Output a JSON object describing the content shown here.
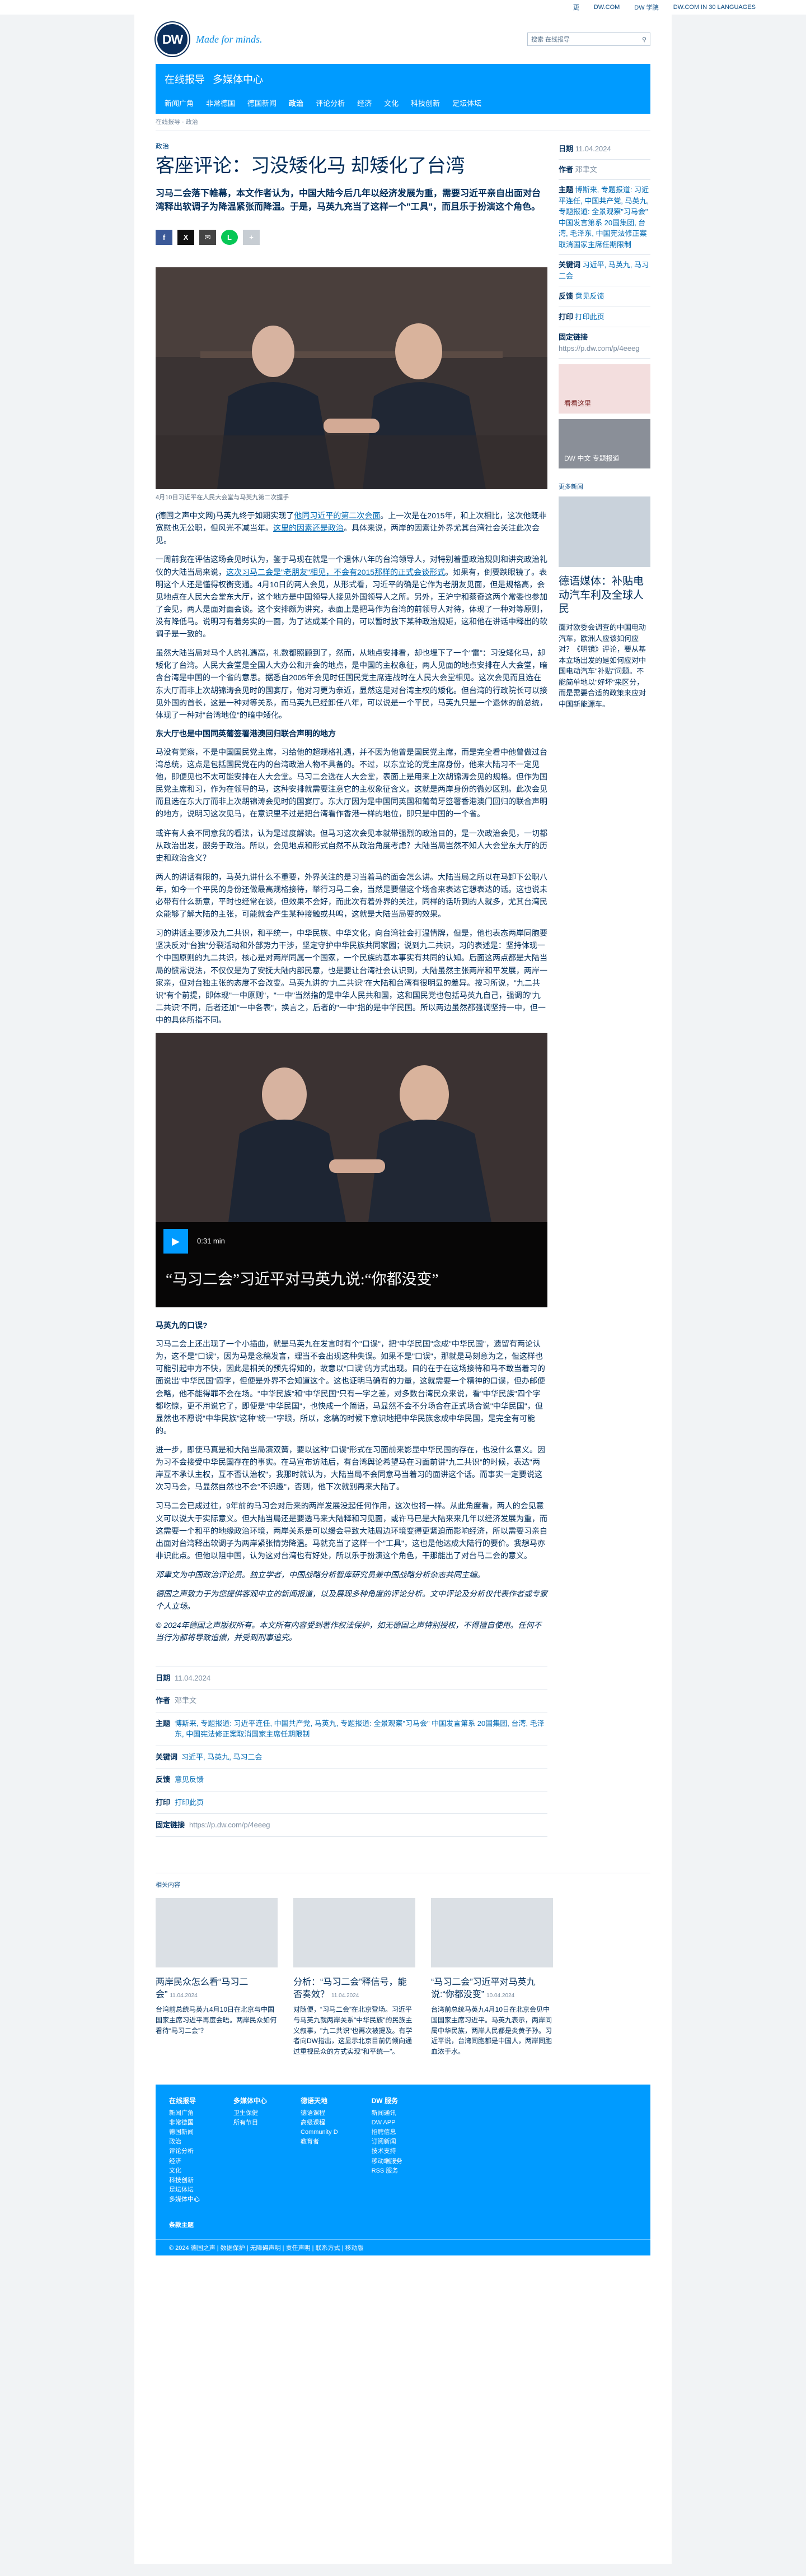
{
  "topbar": {
    "l1": "更",
    "l2": "DW.COM",
    "l3": "DW 学院",
    "l4": "DW.COM IN 30 LANGUAGES"
  },
  "brand": {
    "logo": "DW",
    "slogan": "Made for minds.",
    "search_placeholder": "搜索 在线报导"
  },
  "header": {
    "section": "在线报导",
    "subsection": "多媒体中心",
    "nav": [
      "新闻广角",
      "非常德国",
      "德国新闻",
      "政治",
      "评论分析",
      "经济",
      "文化",
      "科技创新",
      "足坛体坛"
    ]
  },
  "breadcrumb": "在线报导 · 政治",
  "article": {
    "kicker": "政治",
    "title": "客座评论：习没矮化马 却矮化了台湾",
    "lede": "习马二会落下帷幕，本文作者认为，中国大陆今后几年以经济发展为重，需要习近平亲自出面对台湾释出软调子为降温紧张而降温。于是，马英九充当了这样一个\"工具\"，而且乐于扮演这个角色。",
    "caption": "4月10日习近平在人民大会堂与马英九第二次握手",
    "p1a": "(德国之声中文网)马英九终于如期实现了",
    "p1link": "他同习近平的第二次会面",
    "p1b": "。上一次是在2015年，和上次相比，这次他既非宽慰也无公职，但风光不减当年。",
    "p1link2": "这里的因素还是政治",
    "p1c": "。具体来说，两岸的因素让外界尤其台湾社会关注此次会见。",
    "p2a": "一周前我在评估这场会见时认为，鉴于马现在就是一个退休八年的台湾领导人，对特别着重政治规则和讲究政治礼仪的大陆当局来说，",
    "p2link": "这次习马二会是\"老朋友\"相见，不会有2015那样的正式会谈形式",
    "p2b": "。如果有，倒要跌眼镜了。表明这个人还是懂得权衡变通。4月10日的两人会见，从形式看，习近平的确是它作为老朋友见面，但是规格高，会见地点在人民大会堂东大厅，这个地方是中国领导人接见外国领导人之所。另外，王沪宁和蔡奇这两个常委也参加了会见，两人是面对面会谈。这个安排颇为讲究，表面上是把马作为台湾的前领导人对待，体现了一种对等原则，没有降低马。说明习有着务实的一面，为了达成某个目的，可以暂时放下某种政治规矩，这和他在讲话中释出的软调子是一致的。",
    "p3": "虽然大陆当局对马个人的礼遇高，礼数都照顾到了，然而，从地点安排看，却也埋下了一个\"雷\"：习没矮化马，却矮化了台湾。人民大会堂是全国人大办公和开会的地点，是中国的主权象征，两人见面的地点安排在人大会堂，暗含台湾是中国的一个省的意思。据悉自2005年会见时任国民党主席连战时在人民大会堂相见。这次会见而且选在东大厅而非上次胡锦涛会见时的国宴厅，他对习更为亲近，显然这是对台湾主权的矮化。但台湾的行政院长可以接见外国的首长，这是一种对等关系，而马英九已经卸任八年，可以说是一个平民，马英九只是一个退休的前总统，体现了一种对\"台湾地位\"的暗中矮化。",
    "h1": "东大厅也是中国同英葡签署港澳回归联合声明的地方",
    "p4": "马没有觉察，不是中国国民党主席，习给他的超规格礼遇，并不因为他曾是国民党主席，而是完全看中他曾做过台湾总统，这点是包括国民党在内的台湾政治人物不具备的。不过，以东立论的党主席身份，他来大陆习不一定见他，即便见也不太可能安排在人大会堂。马习二会选在人大会堂，表面上是用来上次胡锦涛会见的规格。但作为国民党主席和习，作为在领导的马，这种安排就需要注意它的主权象征含义。这就是两岸身份的微妙区别。此次会见而且选在东大厅而非上次胡锦涛会见时的国宴厅。东大厅因为是中国同英国和葡萄牙签署香港澳门回归的联合声明的地方，说明习这次见马，在意识里不过是把台湾看作香港一样的地位，即只是中国的一个省。",
    "p5": "或许有人会不同意我的看法，认为是过度解读。但马习这次会见本就带强烈的政治目的，是一次政治会见，一切都从政治出发，服务于政治。所以，会见地点和形式自然不从政治角度考虑？大陆当局岂然不知人大会堂东大厅的历史和政治含义？",
    "p6": "两人的讲话有限的，马英九讲什么不重要，外界关注的是习当着马的面会怎么讲。大陆当局之所以在马卸下公职八年，如今一个平民的身份还做最高规格接待，举行习马二会，当然是要借这个场合来表达它想表达的话。这也说未必带有什么新意，平时也经常在谈，但效果不会好，而此次有着外界的关注，同样的话听到的人就多，尤其台湾民众能够了解大陆的主张，可能就会产生某种接触或共鸣，这就是大陆当局要的效果。",
    "p7": "习的讲话主要涉及九二共识，和平统一，中华民族、中华文化，向台湾社会打温情牌，但是，他也表态两岸同胞要坚决反对\"台独\"分裂活动和外部势力干涉，坚定守护中华民族共同家园；说到九二共识，习的表述是：坚持体现一个中国原则的九二共识，核心是对两岸同属一个国家，一个民族的基本事实有共同的认知。后面这两点都是大陆当局的惯常说法，不仅仅是为了安抚大陆内部民意，也是要让台湾社会认识到，大陆虽然主张两岸和平发展，两岸一家亲，但对台独主张的态度不会改变。马英九讲的\"九二共识\"在大陆和台湾有很明显的差异。按习所说，\"九二共识\"有个前提，即体现\"一中原则\"，\"一中\"当然指的是中华人民共和国，这和国民党也包括马英九自己，强调的\"九二共识\"不同，后者还加\"一中各表\"，换言之，后者的\"一中\"指的是中华民国。所以两边虽然都强调坚持一中，但一中的具体所指不同。",
    "h2": "马英九的口误?",
    "p8": "习马二会上还出现了一个小插曲，就是马英九在发言时有个\"口误\"，把\"中华民国\"念成\"中华民国\"，遗留有两论认为，这不是\"口误\"，因为马是念稿发言，理当不会出现这种失误。如果不是\"口误\"，那就是马刻意为之，但这样也可能引起中方不快，因此是相关的预先得知的，故意以\"口误\"的方式出现。目的在于在这场接待和马不敢当着习的面说出\"中华民国\"四字，但便是外界不会知道这个。这也证明马确有的力量，这就需要一个精神的口误，但办邮便会略，他不能得罪不会在场。\"中华民族\"和\"中华民国\"只有一字之差，对多数台湾民众来说，看\"中华民族\"四个字都吃惊，更不用说它了，即便是\"中华民国\"，也快成一个简语，马显然不会不分场合在正式场合说\"中华民国\"，但显然也不愿说\"中华民族\"这种\"统一\"字眼，所以，念稿的时候下意识地把中华民族念成中华民国，是完全有可能的。",
    "p9": "进一步，即使马真是和大陆当局演双簧，要以这种\"口误\"形式在习面前来影显中华民国的存在，也没什么意义。因为习不会接受中华民国存在的事实。在马宣布访陆后，有台湾舆论希望马在习面前讲\"九二共识\"的时候，表达\"两岸互不承认主权，互不否认治权\"，我那时就认为，大陆当局不会同意马当着习的面讲这个话。而事实一定要说这次习马会，马显然自然也不会\"不识趣\"，否则，他下次就别再来大陆了。",
    "p10": "习马二会已成过往，9年前的马习会对后来的两岸发展没起任何作用，这次也将一样。从此角度看，两人的会见意义可以说大于实际意义。但大陆当局还是要透马来大陆释和习见面，或许马已是大陆来来几年以经济发展为重，而这需要一个和平的地缘政治环境，两岸关系是可以缓会导致大陆周边环境变得更紧迫而影响经济，所以需要习亲自出面对台湾释出软调子为两岸紧张情势降温。马就充当了这样一个\"工具\"，这也是他达成大陆行的要价。我想马亦非识此点。但他以阻中国，认为这对台湾也有好处，所以乐于扮演这个角色，干那能出了对台马二会的意义。",
    "author_note": "邓聿文为中国政治评论员。独立学者，中国战略分析智库研究员兼中国战略分析杂志共同主编。",
    "disclaimer": "德国之声致力于为您提供客观中立的新闻报道，以及展现多种角度的评论分析。文中评论及分析仅代表作者或专家个人立场。",
    "copyright": "© 2024年德国之声版权所有。本文所有内容受到著作权法保护，如无德国之声特别授权，不得擅自使用。任何不当行为都将导致追偿，并受到刑事追究。"
  },
  "video": {
    "duration": "0:31 min",
    "title": "“马习二会”习近平对马英九说:“你都没变”"
  },
  "meta": {
    "date_k": "日期",
    "date_v": "11.04.2024",
    "author_k": "作者",
    "author_v": "邓聿文",
    "topic_k": "主题",
    "topic_v": "博斯来, 专题报道: 习近平连任, 中国共产党, 马英九, 专题报道: 全景观察\"习马会\" 中国发言第系 20国集团, 台湾, 毛泽东, 中国宪法修正案取消国家主席任期限制",
    "kw_k": "关键词",
    "kw_v": "习近平, 马英九, 马习二会",
    "fb_k": "反馈",
    "fb_v": "意见反馈",
    "print_k": "打印",
    "print_v": "打印此页",
    "link_k": "固定链接",
    "link_v": "https://p.dw.com/p/4eeeg"
  },
  "sidebar": {
    "date_k": "日期",
    "date_v": "11.04.2024",
    "author_k": "作者",
    "author_v": "邓聿文",
    "topic_k": "主题",
    "topic_v": "博斯来, 专题报道: 习近平连任, 中国共产党, 马英九, 专题报道: 全景观察\"习马会\" 中国发言第系 20国集团, 台湾, 毛泽东, 中国宪法修正案取消国家主席任期限制",
    "kw_k": "关键词",
    "kw_v": "习近平, 马英九, 马习二会",
    "fb_k": "反馈",
    "fb_v": "意见反馈",
    "print_k": "打印",
    "print_v": "打印此页",
    "link_k": "固定链接",
    "link_v": "https://p.dw.com/p/4eeeg",
    "promo1": "看看这里",
    "promo2": "DW 中文 专题报道",
    "more_h": "更多新闻",
    "story_title": "德语媒体：补贴电动汽车利及全球人民",
    "story_text": "面对欧委会调查的中国电动汽车，欧洲人应该如何应对？《明镜》评论，要从基本立场出发的是如何应对中国电动汽车\"补贴\"问题。不能简单地以\"好坏\"来区分，而是需要合适的政策来应对中国新能源车。"
  },
  "related": {
    "heading": "相关内容",
    "cards": [
      {
        "title": "两岸民众怎么看“马习二会”",
        "date": "11.04.2024",
        "desc": "台湾前总统马英九4月10日在北京与中国国家主席习近平再度会晤。两岸民众如何看待“马习二会”？"
      },
      {
        "title": "分析：“马习二会”释信号，能否奏效？",
        "date": "11.04.2024",
        "desc": "对随便，“习马二会”在北京登场。习近平与马英九就两岸关系\"中华民族\"的民族主义叙事，\"九二共识\"也再次被提及。有学者向DW指出，这显示北京目前仍倾向通过重视民众的方式实现\"和平统一\"。"
      },
      {
        "title": "“马习二会”习近平对马英九说:“你都没变”",
        "date": "10.04.2024",
        "desc": "台湾前总统马英九4月10日在北京会见中国国家主席习近平。马英九表示，两岸同属中华民族，两岸人民都是炎黄子孙。习近平说，台湾同胞都是中国人，两岸同胞血浓于水。"
      }
    ]
  },
  "footer": {
    "cols": [
      {
        "h": "在线报导",
        "items": [
          "新闻广角",
          "非常德国",
          "德国新闻",
          "政治",
          "评论分析",
          "经济",
          "文化",
          "科技创新",
          "足坛体坛",
          "多媒体中心"
        ]
      },
      {
        "h": "多媒体中心",
        "items": [
          "卫生保健",
          "所有节目"
        ]
      },
      {
        "h": "德语天地",
        "items": [
          "德语课程",
          "高级课程",
          "Community D",
          "教育者"
        ]
      },
      {
        "h": "DW 服务",
        "items": [
          "新闻通讯",
          "DW APP",
          "招聘信息",
          "订阅新闻",
          "技术支持",
          "移动端服务",
          "RSS 服务"
        ]
      }
    ],
    "bottom": "条款主题",
    "copyright": "© 2024 德国之声 | 数据保护 | 无障碍声明 | 责任声明 | 联系方式 | 移动版"
  }
}
